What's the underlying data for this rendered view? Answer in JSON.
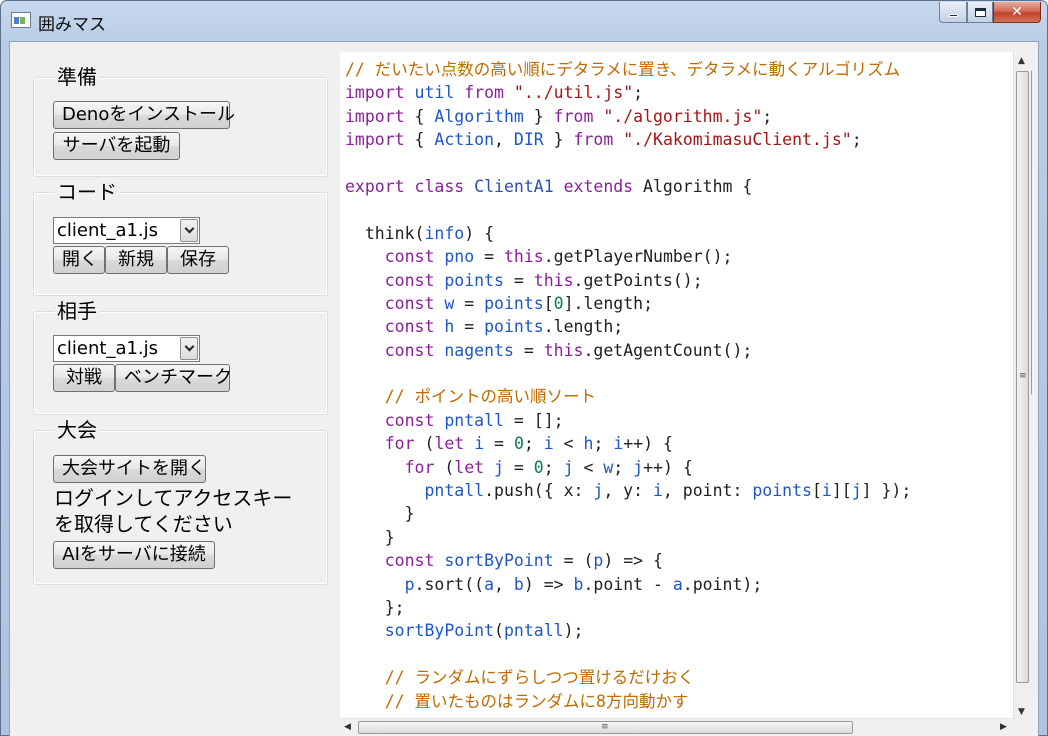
{
  "window": {
    "title": "囲みマス",
    "controls": {
      "minimize": "minimize",
      "maximize": "maximize",
      "close": "✕"
    }
  },
  "sidebar": {
    "prepare": {
      "label": "準備",
      "install_button": "Denoをインストール",
      "start_server_button": "サーバを起動"
    },
    "code": {
      "label": "コード",
      "selected_file": "client_a1.js",
      "open_button": "開く",
      "new_button": "新規",
      "save_button": "保存"
    },
    "opponent": {
      "label": "相手",
      "selected_file": "client_a1.js",
      "battle_button": "対戦",
      "benchmark_button": "ベンチマーク"
    },
    "tournament": {
      "label": "大会",
      "open_site_button": "大会サイトを開く",
      "instruction_line1": "ログインしてアクセスキー",
      "instruction_line2": "を取得してください",
      "connect_button": "AIをサーバに接続"
    }
  },
  "editor": {
    "lines": [
      [
        [
          "cmt",
          "// だいたい点数の高い順にデタラメに置き、デタラメに動くアルゴリズム"
        ]
      ],
      [
        [
          "kw",
          "import"
        ],
        [
          "plain",
          " "
        ],
        [
          "var",
          "util"
        ],
        [
          "plain",
          " "
        ],
        [
          "kw",
          "from"
        ],
        [
          "plain",
          " "
        ],
        [
          "str",
          "\"../util.js\""
        ],
        [
          "plain",
          ";"
        ]
      ],
      [
        [
          "kw",
          "import"
        ],
        [
          "plain",
          " { "
        ],
        [
          "var",
          "Algorithm"
        ],
        [
          "plain",
          " } "
        ],
        [
          "kw",
          "from"
        ],
        [
          "plain",
          " "
        ],
        [
          "str",
          "\"./algorithm.js\""
        ],
        [
          "plain",
          ";"
        ]
      ],
      [
        [
          "kw",
          "import"
        ],
        [
          "plain",
          " { "
        ],
        [
          "var",
          "Action"
        ],
        [
          "plain",
          ", "
        ],
        [
          "var",
          "DIR"
        ],
        [
          "plain",
          " } "
        ],
        [
          "kw",
          "from"
        ],
        [
          "plain",
          " "
        ],
        [
          "str",
          "\"./KakomimasuClient.js\""
        ],
        [
          "plain",
          ";"
        ]
      ],
      [
        [
          "plain",
          ""
        ]
      ],
      [
        [
          "kw",
          "export"
        ],
        [
          "plain",
          " "
        ],
        [
          "kw",
          "class"
        ],
        [
          "plain",
          " "
        ],
        [
          "cls",
          "ClientA1"
        ],
        [
          "plain",
          " "
        ],
        [
          "kw",
          "extends"
        ],
        [
          "plain",
          " Algorithm {"
        ]
      ],
      [
        [
          "plain",
          ""
        ]
      ],
      [
        [
          "plain",
          "  think("
        ],
        [
          "var",
          "info"
        ],
        [
          "plain",
          ") {"
        ]
      ],
      [
        [
          "plain",
          "    "
        ],
        [
          "kw",
          "const"
        ],
        [
          "plain",
          " "
        ],
        [
          "var",
          "pno"
        ],
        [
          "plain",
          " = "
        ],
        [
          "kw",
          "this"
        ],
        [
          "plain",
          ".getPlayerNumber();"
        ]
      ],
      [
        [
          "plain",
          "    "
        ],
        [
          "kw",
          "const"
        ],
        [
          "plain",
          " "
        ],
        [
          "var",
          "points"
        ],
        [
          "plain",
          " = "
        ],
        [
          "kw",
          "this"
        ],
        [
          "plain",
          ".getPoints();"
        ]
      ],
      [
        [
          "plain",
          "    "
        ],
        [
          "kw",
          "const"
        ],
        [
          "plain",
          " "
        ],
        [
          "var",
          "w"
        ],
        [
          "plain",
          " = "
        ],
        [
          "var",
          "points"
        ],
        [
          "plain",
          "["
        ],
        [
          "num",
          "0"
        ],
        [
          "plain",
          "].length;"
        ]
      ],
      [
        [
          "plain",
          "    "
        ],
        [
          "kw",
          "const"
        ],
        [
          "plain",
          " "
        ],
        [
          "var",
          "h"
        ],
        [
          "plain",
          " = "
        ],
        [
          "var",
          "points"
        ],
        [
          "plain",
          ".length;"
        ]
      ],
      [
        [
          "plain",
          "    "
        ],
        [
          "kw",
          "const"
        ],
        [
          "plain",
          " "
        ],
        [
          "var",
          "nagents"
        ],
        [
          "plain",
          " = "
        ],
        [
          "kw",
          "this"
        ],
        [
          "plain",
          ".getAgentCount();"
        ]
      ],
      [
        [
          "plain",
          ""
        ]
      ],
      [
        [
          "plain",
          "    "
        ],
        [
          "cmt",
          "// ポイントの高い順ソート"
        ]
      ],
      [
        [
          "plain",
          "    "
        ],
        [
          "kw",
          "const"
        ],
        [
          "plain",
          " "
        ],
        [
          "var",
          "pntall"
        ],
        [
          "plain",
          " = [];"
        ]
      ],
      [
        [
          "plain",
          "    "
        ],
        [
          "kw",
          "for"
        ],
        [
          "plain",
          " ("
        ],
        [
          "kw",
          "let"
        ],
        [
          "plain",
          " "
        ],
        [
          "var",
          "i"
        ],
        [
          "plain",
          " = "
        ],
        [
          "num",
          "0"
        ],
        [
          "plain",
          "; "
        ],
        [
          "var",
          "i"
        ],
        [
          "plain",
          " < "
        ],
        [
          "var",
          "h"
        ],
        [
          "plain",
          "; "
        ],
        [
          "var",
          "i"
        ],
        [
          "plain",
          "++) {"
        ]
      ],
      [
        [
          "plain",
          "      "
        ],
        [
          "kw",
          "for"
        ],
        [
          "plain",
          " ("
        ],
        [
          "kw",
          "let"
        ],
        [
          "plain",
          " "
        ],
        [
          "var",
          "j"
        ],
        [
          "plain",
          " = "
        ],
        [
          "num",
          "0"
        ],
        [
          "plain",
          "; "
        ],
        [
          "var",
          "j"
        ],
        [
          "plain",
          " < "
        ],
        [
          "var",
          "w"
        ],
        [
          "plain",
          "; "
        ],
        [
          "var",
          "j"
        ],
        [
          "plain",
          "++) {"
        ]
      ],
      [
        [
          "plain",
          "        "
        ],
        [
          "var",
          "pntall"
        ],
        [
          "plain",
          ".push({ x: "
        ],
        [
          "var",
          "j"
        ],
        [
          "plain",
          ", y: "
        ],
        [
          "var",
          "i"
        ],
        [
          "plain",
          ", point: "
        ],
        [
          "var",
          "points"
        ],
        [
          "plain",
          "["
        ],
        [
          "var",
          "i"
        ],
        [
          "plain",
          "]["
        ],
        [
          "var",
          "j"
        ],
        [
          "plain",
          "] });"
        ]
      ],
      [
        [
          "plain",
          "      }"
        ]
      ],
      [
        [
          "plain",
          "    }"
        ]
      ],
      [
        [
          "plain",
          "    "
        ],
        [
          "kw",
          "const"
        ],
        [
          "plain",
          " "
        ],
        [
          "var",
          "sortByPoint"
        ],
        [
          "plain",
          " = ("
        ],
        [
          "var",
          "p"
        ],
        [
          "plain",
          ") => {"
        ]
      ],
      [
        [
          "plain",
          "      "
        ],
        [
          "var",
          "p"
        ],
        [
          "plain",
          ".sort(("
        ],
        [
          "var",
          "a"
        ],
        [
          "plain",
          ", "
        ],
        [
          "var",
          "b"
        ],
        [
          "plain",
          ") => "
        ],
        [
          "var",
          "b"
        ],
        [
          "plain",
          ".point - "
        ],
        [
          "var",
          "a"
        ],
        [
          "plain",
          ".point);"
        ]
      ],
      [
        [
          "plain",
          "    };"
        ]
      ],
      [
        [
          "plain",
          "    "
        ],
        [
          "var",
          "sortByPoint"
        ],
        [
          "plain",
          "("
        ],
        [
          "var",
          "pntall"
        ],
        [
          "plain",
          ");"
        ]
      ],
      [
        [
          "plain",
          ""
        ]
      ],
      [
        [
          "plain",
          "    "
        ],
        [
          "cmt",
          "// ランダムにずらしつつ置けるだけおく"
        ]
      ],
      [
        [
          "plain",
          "    "
        ],
        [
          "cmt",
          "// 置いたものはランダムに8方向動かす"
        ]
      ]
    ]
  },
  "scrollbars": {
    "up_arrow": "▲",
    "down_arrow": "▼",
    "left_arrow": "◀",
    "right_arrow": "▶",
    "grip": "≡"
  }
}
